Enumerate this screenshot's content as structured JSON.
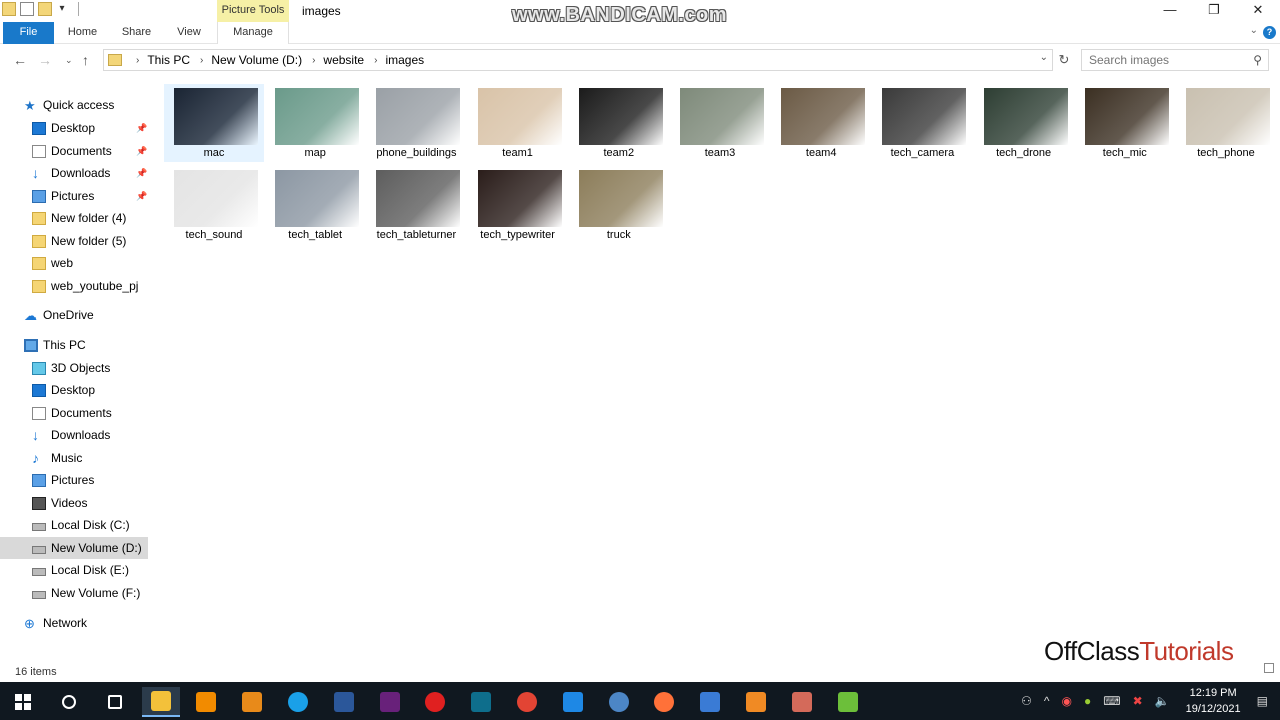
{
  "window": {
    "title": "images",
    "contextual_tab": "Picture Tools"
  },
  "ribbon": {
    "tabs": [
      "File",
      "Home",
      "Share",
      "View",
      "Manage"
    ]
  },
  "address": {
    "crumbs": [
      "This PC",
      "New Volume (D:)",
      "website",
      "images"
    ],
    "search_placeholder": "Search images"
  },
  "sidebar": {
    "quick_access": "Quick access",
    "quick_items": [
      "Desktop",
      "Documents",
      "Downloads",
      "Pictures",
      "New folder (4)",
      "New folder (5)",
      "web",
      "web_youtube_pj"
    ],
    "onedrive": "OneDrive",
    "this_pc": "This PC",
    "pc_items": [
      "3D Objects",
      "Desktop",
      "Documents",
      "Downloads",
      "Music",
      "Pictures",
      "Videos",
      "Local Disk (C:)",
      "New Volume (D:)",
      "Local Disk (E:)",
      "New Volume (F:)"
    ],
    "network": "Network",
    "selected": "New Volume (D:)"
  },
  "files": [
    {
      "name": "mac",
      "color": "#1a2433"
    },
    {
      "name": "map",
      "color": "#6a9a8a"
    },
    {
      "name": "phone_buildings",
      "color": "#9aa0a6"
    },
    {
      "name": "team1",
      "color": "#d9c3a8"
    },
    {
      "name": "team2",
      "color": "#1b1b1b"
    },
    {
      "name": "team3",
      "color": "#7e8a7a"
    },
    {
      "name": "team4",
      "color": "#6b5a45"
    },
    {
      "name": "tech_camera",
      "color": "#3a3a3a"
    },
    {
      "name": "tech_drone",
      "color": "#2d3e33"
    },
    {
      "name": "tech_mic",
      "color": "#3b2f22"
    },
    {
      "name": "tech_phone",
      "color": "#c9c0b0"
    },
    {
      "name": "tech_sound",
      "color": "#e4e4e4"
    },
    {
      "name": "tech_tablet",
      "color": "#8c97a3"
    },
    {
      "name": "tech_tableturner",
      "color": "#5d5d5d"
    },
    {
      "name": "tech_typewriter",
      "color": "#2a1d1a"
    },
    {
      "name": "truck",
      "color": "#8c7d5a"
    }
  ],
  "status": {
    "item_count": "16 items"
  },
  "overlay": {
    "watermark": "www.BANDICAM.com",
    "brand_part1": "OffClass",
    "brand_part2": "Tutorials"
  },
  "taskbar": {
    "time": "12:19 PM",
    "date": "19/12/2021",
    "apps": [
      {
        "name": "search-icon",
        "color": "#101820"
      },
      {
        "name": "task-view-icon",
        "color": "#101820"
      },
      {
        "name": "file-explorer-icon",
        "color": "#f3c13a"
      },
      {
        "name": "vlc-icon",
        "color": "#f28b00"
      },
      {
        "name": "sublime-icon",
        "color": "#e88a1a"
      },
      {
        "name": "photos-icon",
        "color": "#1aa0e8"
      },
      {
        "name": "word-icon",
        "color": "#2b579a"
      },
      {
        "name": "visual-studio-icon",
        "color": "#68217a"
      },
      {
        "name": "record-icon",
        "color": "#e02020"
      },
      {
        "name": "app-icon",
        "color": "#0e6e8c"
      },
      {
        "name": "chrome-icon",
        "color": "#e24434"
      },
      {
        "name": "edge-ie-icon",
        "color": "#1e88e5"
      },
      {
        "name": "globe-icon",
        "color": "#4c86c6"
      },
      {
        "name": "firefox-icon",
        "color": "#ff7139"
      },
      {
        "name": "app2-icon",
        "color": "#3a7bd5"
      },
      {
        "name": "app3-icon",
        "color": "#f08a24"
      },
      {
        "name": "app4-icon",
        "color": "#d46a5a"
      },
      {
        "name": "notepad-icon",
        "color": "#6cbf3a"
      }
    ]
  }
}
